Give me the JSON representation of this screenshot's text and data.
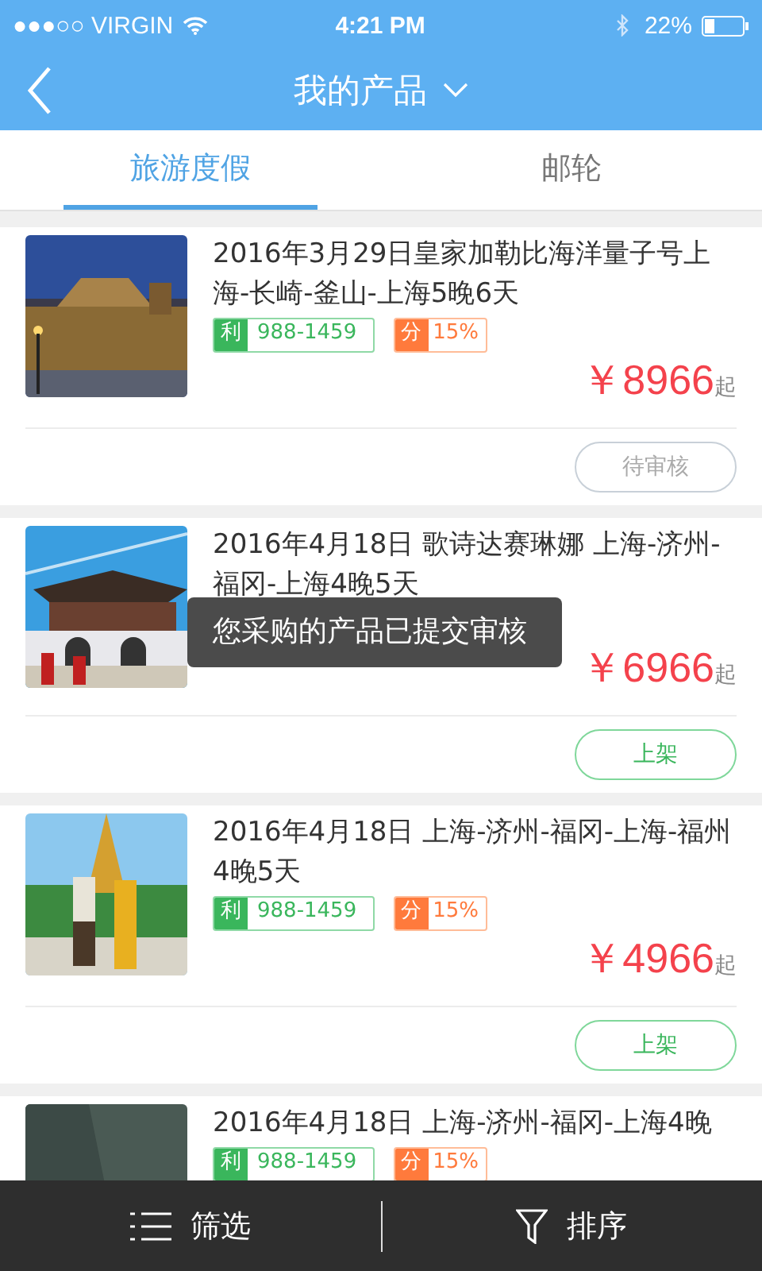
{
  "status_bar": {
    "carrier": "●●●○○ VIRGIN",
    "time": "4:21 PM",
    "battery": "22%"
  },
  "nav": {
    "title": "我的产品"
  },
  "tabs": [
    {
      "label": "旅游度假",
      "selected": true
    },
    {
      "label": "邮轮",
      "selected": false
    }
  ],
  "products": [
    {
      "title": "2016年3月29日皇家加勒比海洋量子号上海-长崎-釜山-上海5晚6天",
      "profit_label": "利",
      "profit": "988-1459",
      "share_label": "分",
      "share": "15%",
      "price": "￥8966",
      "price_suffix": "起",
      "button": {
        "label": "待审核",
        "kind": "pending"
      }
    },
    {
      "title": "2016年4月18日 歌诗达赛琳娜 上海-济州-福冈-上海4晚5天",
      "price": "￥6966",
      "price_suffix": "起",
      "button": {
        "label": "上架",
        "kind": "shelve"
      }
    },
    {
      "title": "2016年4月18日 上海-济州-福冈-上海-福州4晚5天",
      "profit_label": "利",
      "profit": "988-1459",
      "share_label": "分",
      "share": "15%",
      "price": "￥4966",
      "price_suffix": "起",
      "button": {
        "label": "上架",
        "kind": "shelve"
      }
    },
    {
      "title": "2016年4月18日 上海-济州-福冈-上海4晚",
      "profit_label": "利",
      "profit": "988-1459",
      "share_label": "分",
      "share": "15%"
    }
  ],
  "toast": "您采购的产品已提交审核",
  "bottom_bar": {
    "filter": "筛选",
    "sort": "排序"
  }
}
